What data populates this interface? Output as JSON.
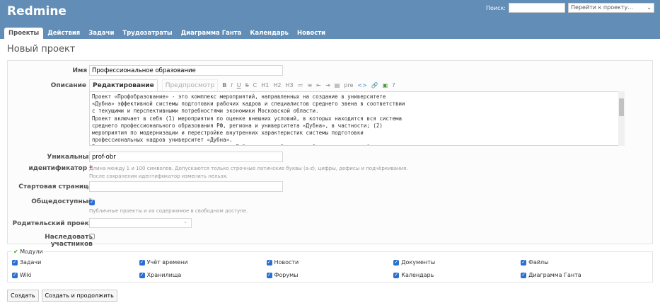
{
  "header": {
    "logo": "Redmine",
    "search_label": "Поиск:",
    "jump_label": "Перейти к проекту..."
  },
  "tabs": [
    "Проекты",
    "Действия",
    "Задачи",
    "Трудозатраты",
    "Диаграмма Ганта",
    "Календарь",
    "Новости"
  ],
  "page_title": "Новый проект",
  "form": {
    "name_label": "Имя",
    "name_value": "Профессиональное образование",
    "desc_label": "Описание",
    "edit_tab": "Редактирование",
    "preview_tab": "Предпросмотр",
    "toolbar": [
      "B",
      "I",
      "U",
      "S",
      "C",
      "H1",
      "H2",
      "H3",
      "≔",
      "≡",
      "⇤",
      "⇥",
      "▤",
      "pre",
      "<>",
      "🔗",
      "▣",
      "?"
    ],
    "description": "Проект «Профобразование» - это комплекс мероприятий, направленных на создание в университете\n«Дубна» эффективной системы подготовки рабочих кадров и специалистов среднего звена в соответствии\nс текущими и перспективными потребностями экономики Московской области.\nПроект включает в себя (1) мероприятия по оценке внешних условий, в которых находится вся система\nсреднего профессионального образования РФ, региона и университета «Дубна», в частности; (2)\nмероприятия по модернизации и перестройке внутренних характеристик системы подготовки\nпрофессиональных кадров университет «Дубна».\nВ результате реализации проекта университет «Дубна» должен быть способен решать широкий спектр",
    "id_label1": "Уникальный",
    "id_label2": "идентификатор",
    "id_value": "prof-obr",
    "id_hint1": "Длина между 1 и 100 символов. Допускаются только строчные латинские буквы (a-z), цифры, дефисы и подчёркивания.",
    "id_hint2": "После сохранения идентификатор изменить нельзя.",
    "home_label": "Стартовая страница",
    "public_label": "Общедоступный",
    "public_hint": "Публичные проекты и их содержимое в свободном доступе.",
    "parent_label": "Родительский проект",
    "inherit_label": "Наследовать участников"
  },
  "modules": {
    "legend": "Модули",
    "items": [
      "Задачи",
      "Учёт времени",
      "Новости",
      "Документы",
      "Файлы",
      "Wiki",
      "Хранилища",
      "Форумы",
      "Календарь",
      "Диаграмма Ганта"
    ]
  },
  "buttons": {
    "create": "Создать",
    "create_continue": "Создать и продолжить"
  }
}
